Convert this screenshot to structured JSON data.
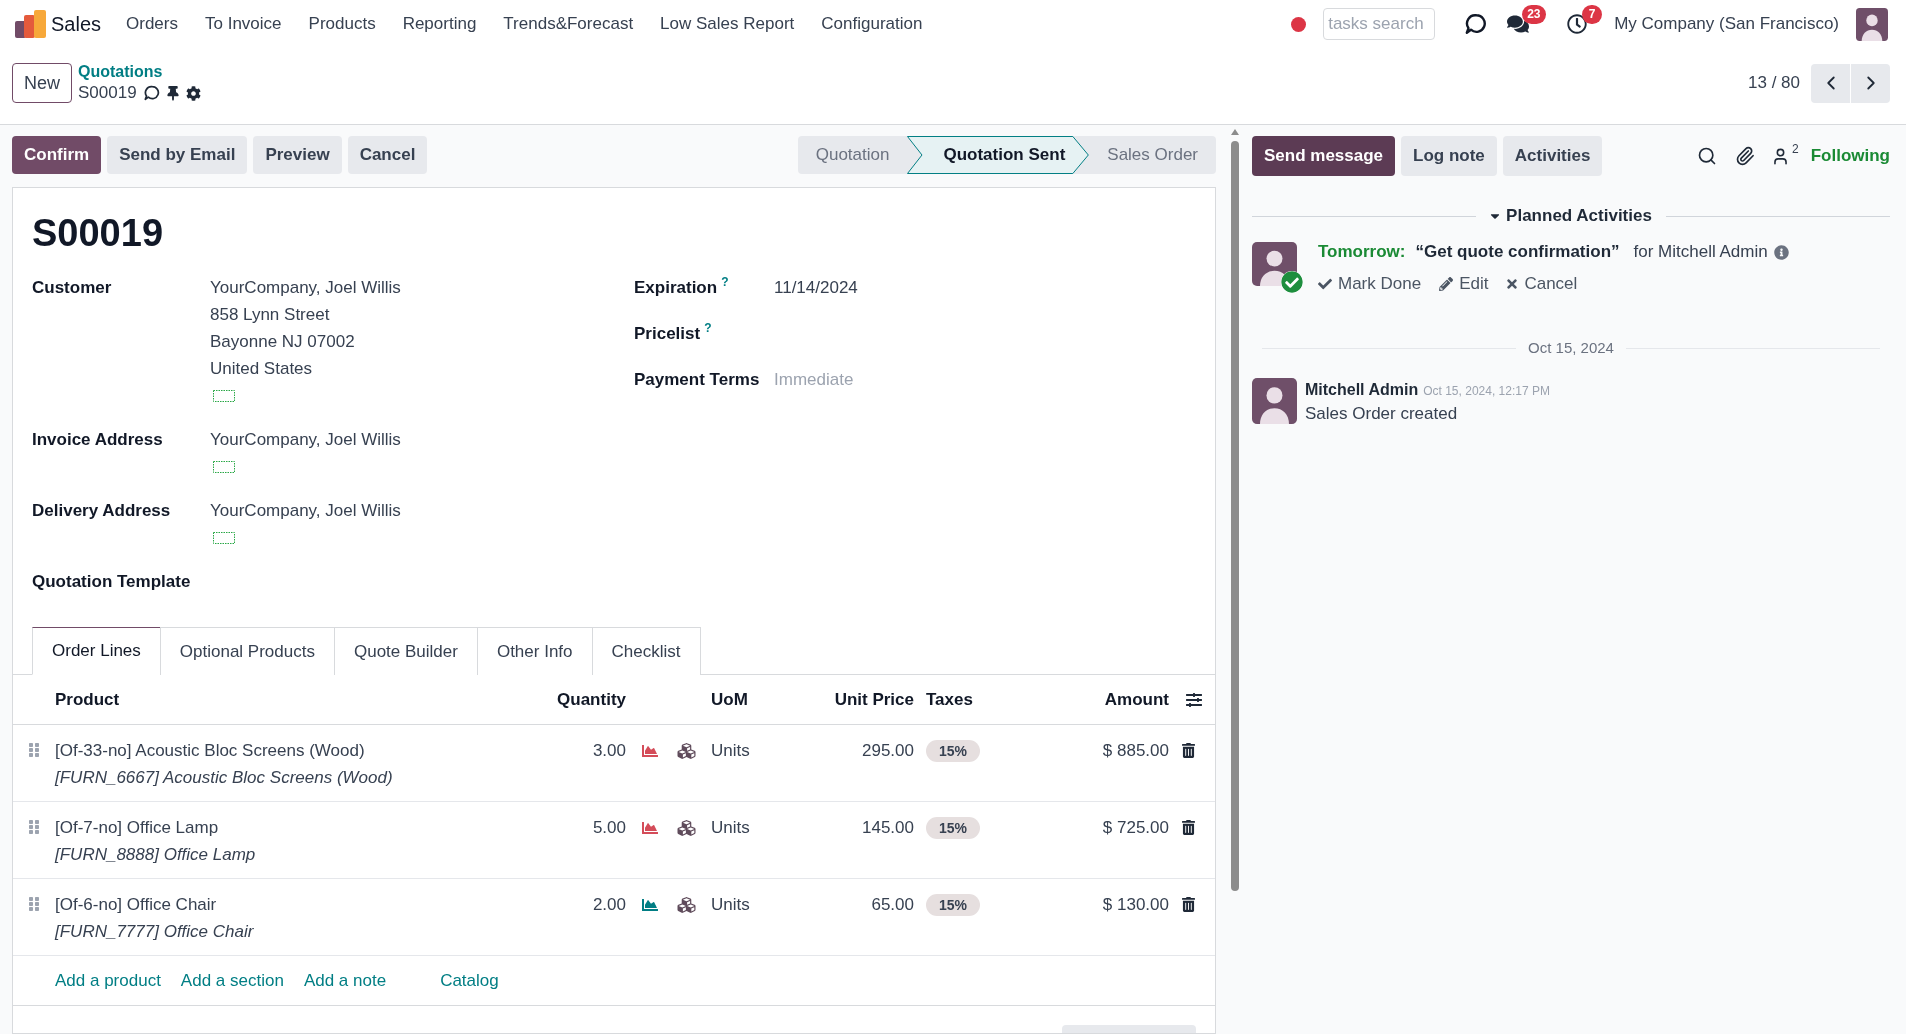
{
  "navbar": {
    "app_name": "Sales",
    "menu": [
      "Orders",
      "To Invoice",
      "Products",
      "Reporting",
      "Trends&Forecast",
      "Low Sales Report",
      "Configuration"
    ],
    "search": {
      "placeholder": "tasks search"
    },
    "systray": [
      {
        "kind": "discuss"
      },
      {
        "kind": "messages",
        "badge": "23"
      },
      {
        "kind": "activities",
        "badge": "7"
      }
    ],
    "company": "My Company (San Francisco)"
  },
  "control_panel": {
    "new_button": "New",
    "breadcrumb": "Quotations",
    "record": "S00019",
    "pager": "13 / 80"
  },
  "action_buttons": [
    {
      "label": "Confirm",
      "primary": true
    },
    {
      "label": "Send by Email",
      "primary": false
    },
    {
      "label": "Preview",
      "primary": false
    },
    {
      "label": "Cancel",
      "primary": false
    }
  ],
  "status_bar": [
    {
      "label": "Quotation",
      "selected": false
    },
    {
      "label": "Quotation Sent",
      "selected": true
    },
    {
      "label": "Sales Order",
      "selected": false
    }
  ],
  "form": {
    "title": "S00019",
    "left_fields": [
      {
        "label": "Customer",
        "lines": [
          "YourCompany, Joel Willis",
          "858 Lynn Street",
          "Bayonne NJ 07002",
          "United States"
        ]
      },
      {
        "label": "Invoice Address",
        "lines": [
          "YourCompany, Joel Willis"
        ]
      },
      {
        "label": "Delivery Address",
        "lines": [
          "YourCompany, Joel Willis"
        ]
      },
      {
        "label": "Quotation Template"
      }
    ],
    "right_fields": [
      {
        "label": "Expiration",
        "help": "?",
        "value": "11/14/2024"
      },
      {
        "label": "Pricelist",
        "help": "?"
      },
      {
        "label": "Payment Terms",
        "placeholder": "Immediate"
      }
    ]
  },
  "tabs": [
    {
      "label": "Order Lines",
      "selected": true
    },
    {
      "label": "Optional Products",
      "selected": false
    },
    {
      "label": "Quote Builder",
      "selected": false
    },
    {
      "label": "Other Info",
      "selected": false
    },
    {
      "label": "Checklist",
      "selected": false
    }
  ],
  "order_lines": {
    "columns": [
      "Product",
      "Quantity",
      "UoM",
      "Unit Price",
      "Taxes",
      "Amount"
    ],
    "rows": [
      {
        "product": "[Of-33-no] Acoustic Bloc Screens (Wood)",
        "description": "[FURN_6667] Acoustic Bloc Screens (Wood)",
        "quantity": "3.00",
        "color": "#d44c59",
        "uom": "Units",
        "unit_price": "295.00",
        "taxes": "15%",
        "amount": "$ 885.00"
      },
      {
        "product": "[Of-7-no] Office Lamp",
        "description": "[FURN_8888] Office Lamp",
        "quantity": "5.00",
        "color": "#d44c59",
        "uom": "Units",
        "unit_price": "145.00",
        "taxes": "15%",
        "amount": "$ 725.00"
      },
      {
        "product": "[Of-6-no] Office Chair",
        "description": "[FURN_7777] Office Chair",
        "quantity": "2.00",
        "color": "#017e84",
        "uom": "Units",
        "unit_price": "65.00",
        "taxes": "15%",
        "amount": "$ 130.00"
      }
    ],
    "add_links": [
      "Add a product",
      "Add a section",
      "Add a note",
      "Catalog"
    ]
  },
  "chatter": {
    "buttons": [
      {
        "label": "Send message",
        "primary": true
      },
      {
        "label": "Log note",
        "primary": false
      },
      {
        "label": "Activities",
        "primary": false
      }
    ],
    "followers": "2",
    "follow_label": "Following",
    "planned": {
      "title": "Planned Activities",
      "expanded": true,
      "activities": [
        {
          "due": "Tomorrow:",
          "summary": "“Get quote confirmation”",
          "assignee": "for Mitchell Admin",
          "actions": [
            {
              "kind": "done",
              "label": "Mark Done"
            },
            {
              "kind": "edit",
              "label": "Edit"
            },
            {
              "kind": "cancel",
              "label": "Cancel"
            }
          ]
        }
      ]
    },
    "date_separator": "Oct 15, 2024",
    "messages": [
      {
        "author": "Mitchell Admin",
        "date": "Oct 15, 2024, 12:17 PM",
        "body": "Sales Order created"
      }
    ]
  }
}
